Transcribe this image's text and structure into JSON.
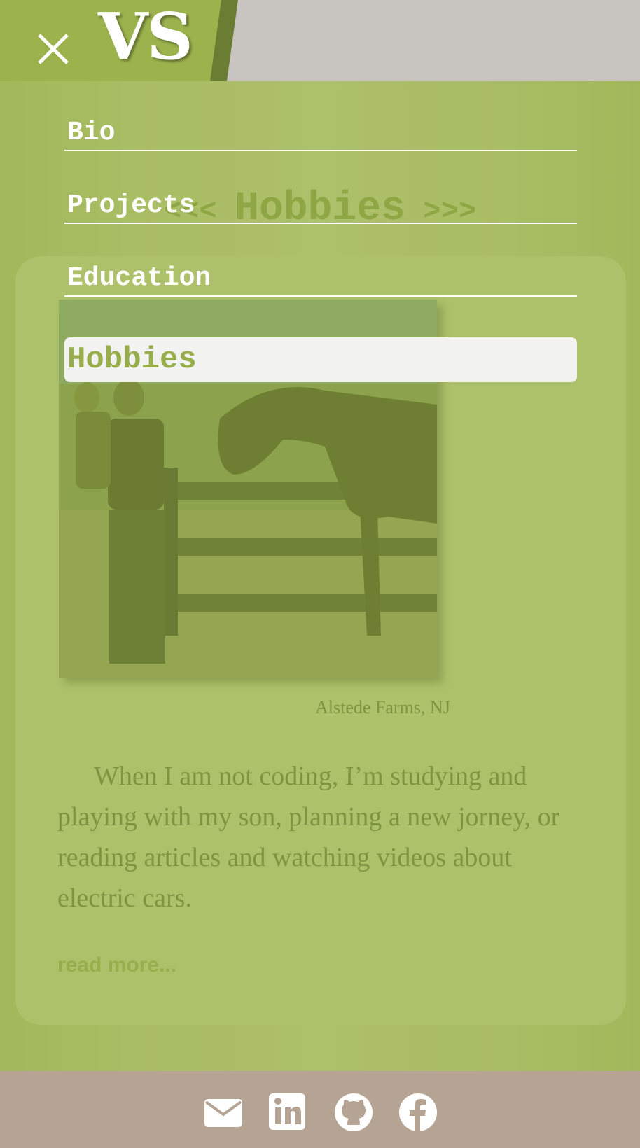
{
  "header": {
    "logo_text": "VS",
    "close_icon": "close-icon"
  },
  "nav": {
    "items": [
      {
        "label": "Bio"
      },
      {
        "label": "Projects"
      },
      {
        "label": "Education"
      },
      {
        "label": "Hobbies",
        "active": true
      }
    ]
  },
  "section": {
    "prev_arrows": "<<<",
    "title": "Hobbies",
    "next_arrows": ">>>"
  },
  "hobbies": {
    "photo_caption": "Alstede Farms, NJ",
    "paragraph": "When I am not coding, I’m studying and playing with my son, planning a new jorney, or reading articles and watching videos about electric cars.",
    "read_more": "read more..."
  },
  "footer": {
    "icons": [
      "email-icon",
      "linkedin-icon",
      "github-icon",
      "facebook-icon"
    ]
  },
  "colors": {
    "accent_green": "#9bb24d",
    "header_gray": "#c8c5c1",
    "footer_tan": "#b5a493",
    "text_olive": "#7f9440"
  }
}
